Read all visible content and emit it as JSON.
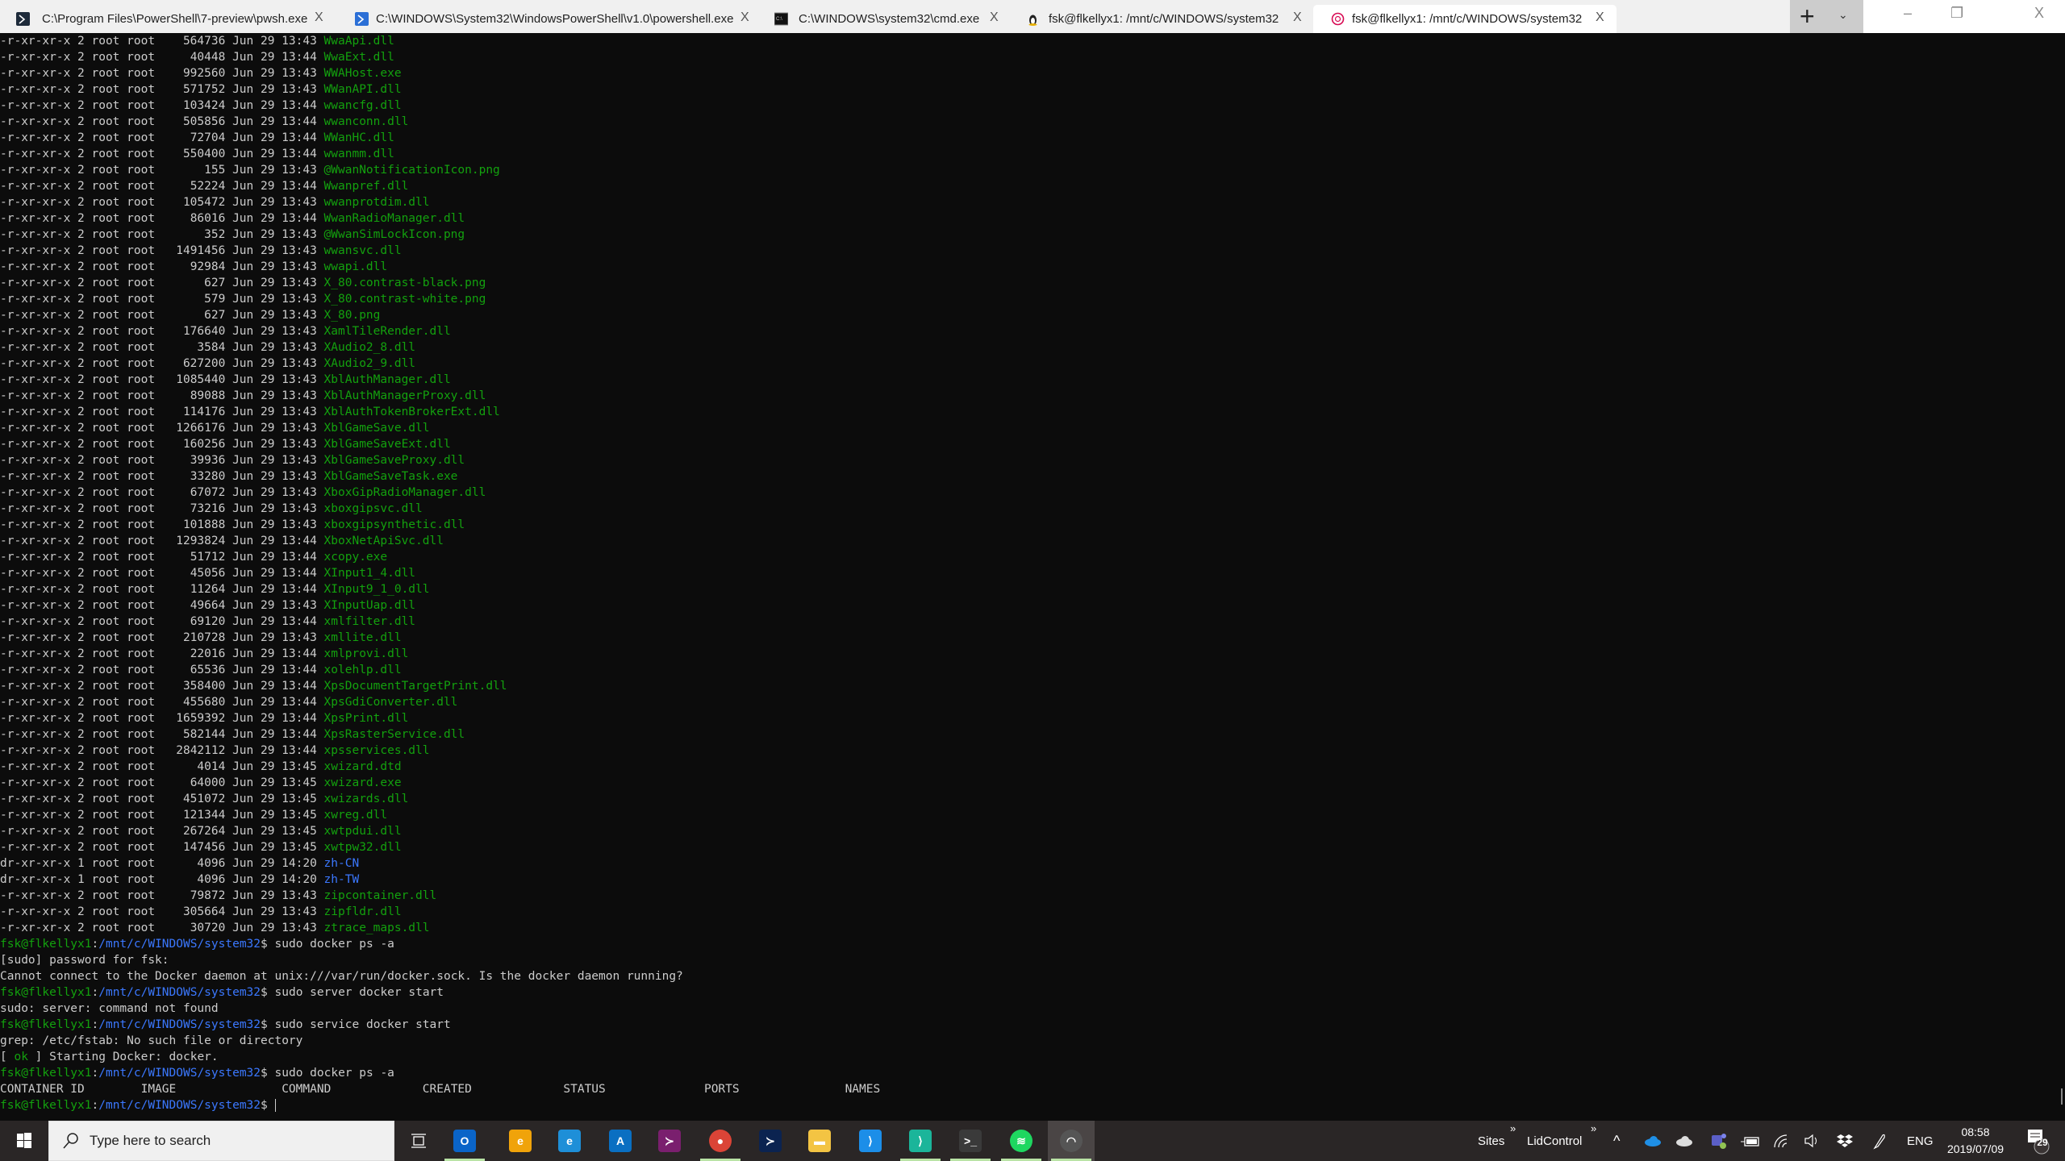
{
  "tabs": [
    {
      "label": "C:\\Program Files\\PowerShell\\7-preview\\pwsh.exe",
      "icon": "pwsh-icon",
      "active": false
    },
    {
      "label": "C:\\WINDOWS\\System32\\WindowsPowerShell\\v1.0\\powershell.exe",
      "icon": "powershell-icon",
      "active": false
    },
    {
      "label": "C:\\WINDOWS\\system32\\cmd.exe",
      "icon": "cmd-icon",
      "active": false
    },
    {
      "label": "fsk@flkellyx1: /mnt/c/WINDOWS/system32",
      "icon": "linux-penguin-icon",
      "active": false
    },
    {
      "label": "fsk@flkellyx1: /mnt/c/WINDOWS/system32",
      "icon": "debian-icon",
      "active": true
    }
  ],
  "tab_close": "X",
  "new_tab": "+",
  "dropdown": "⌄",
  "window_controls": {
    "minimize": "–",
    "restore": "❐",
    "close": "X"
  },
  "colors": {
    "bg": "#0c0c0c",
    "fg": "#cccccc",
    "green": "#13a10e",
    "blue": "#3b78ff",
    "taskbar": "#2a2626"
  },
  "listing": [
    [
      "-r-xr-xr-x",
      "2",
      "root",
      "root",
      "564736",
      "Jun 29",
      "13:43",
      "WwaApi.dll",
      "f"
    ],
    [
      "-r-xr-xr-x",
      "2",
      "root",
      "root",
      "40448",
      "Jun 29",
      "13:44",
      "WwaExt.dll",
      "f"
    ],
    [
      "-r-xr-xr-x",
      "2",
      "root",
      "root",
      "992560",
      "Jun 29",
      "13:43",
      "WWAHost.exe",
      "f"
    ],
    [
      "-r-xr-xr-x",
      "2",
      "root",
      "root",
      "571752",
      "Jun 29",
      "13:43",
      "WWanAPI.dll",
      "f"
    ],
    [
      "-r-xr-xr-x",
      "2",
      "root",
      "root",
      "103424",
      "Jun 29",
      "13:44",
      "wwancfg.dll",
      "f"
    ],
    [
      "-r-xr-xr-x",
      "2",
      "root",
      "root",
      "505856",
      "Jun 29",
      "13:44",
      "wwanconn.dll",
      "f"
    ],
    [
      "-r-xr-xr-x",
      "2",
      "root",
      "root",
      "72704",
      "Jun 29",
      "13:44",
      "WWanHC.dll",
      "f"
    ],
    [
      "-r-xr-xr-x",
      "2",
      "root",
      "root",
      "550400",
      "Jun 29",
      "13:44",
      "wwanmm.dll",
      "f"
    ],
    [
      "-r-xr-xr-x",
      "2",
      "root",
      "root",
      "155",
      "Jun 29",
      "13:43",
      "@WwanNotificationIcon.png",
      "f"
    ],
    [
      "-r-xr-xr-x",
      "2",
      "root",
      "root",
      "52224",
      "Jun 29",
      "13:44",
      "Wwanpref.dll",
      "f"
    ],
    [
      "-r-xr-xr-x",
      "2",
      "root",
      "root",
      "105472",
      "Jun 29",
      "13:43",
      "wwanprotdim.dll",
      "f"
    ],
    [
      "-r-xr-xr-x",
      "2",
      "root",
      "root",
      "86016",
      "Jun 29",
      "13:44",
      "WwanRadioManager.dll",
      "f"
    ],
    [
      "-r-xr-xr-x",
      "2",
      "root",
      "root",
      "352",
      "Jun 29",
      "13:43",
      "@WwanSimLockIcon.png",
      "f"
    ],
    [
      "-r-xr-xr-x",
      "2",
      "root",
      "root",
      "1491456",
      "Jun 29",
      "13:43",
      "wwansvc.dll",
      "f"
    ],
    [
      "-r-xr-xr-x",
      "2",
      "root",
      "root",
      "92984",
      "Jun 29",
      "13:43",
      "wwapi.dll",
      "f"
    ],
    [
      "-r-xr-xr-x",
      "2",
      "root",
      "root",
      "627",
      "Jun 29",
      "13:43",
      "X_80.contrast-black.png",
      "f"
    ],
    [
      "-r-xr-xr-x",
      "2",
      "root",
      "root",
      "579",
      "Jun 29",
      "13:43",
      "X_80.contrast-white.png",
      "f"
    ],
    [
      "-r-xr-xr-x",
      "2",
      "root",
      "root",
      "627",
      "Jun 29",
      "13:43",
      "X_80.png",
      "f"
    ],
    [
      "-r-xr-xr-x",
      "2",
      "root",
      "root",
      "176640",
      "Jun 29",
      "13:43",
      "XamlTileRender.dll",
      "f"
    ],
    [
      "-r-xr-xr-x",
      "2",
      "root",
      "root",
      "3584",
      "Jun 29",
      "13:43",
      "XAudio2_8.dll",
      "f"
    ],
    [
      "-r-xr-xr-x",
      "2",
      "root",
      "root",
      "627200",
      "Jun 29",
      "13:43",
      "XAudio2_9.dll",
      "f"
    ],
    [
      "-r-xr-xr-x",
      "2",
      "root",
      "root",
      "1085440",
      "Jun 29",
      "13:43",
      "XblAuthManager.dll",
      "f"
    ],
    [
      "-r-xr-xr-x",
      "2",
      "root",
      "root",
      "89088",
      "Jun 29",
      "13:43",
      "XblAuthManagerProxy.dll",
      "f"
    ],
    [
      "-r-xr-xr-x",
      "2",
      "root",
      "root",
      "114176",
      "Jun 29",
      "13:43",
      "XblAuthTokenBrokerExt.dll",
      "f"
    ],
    [
      "-r-xr-xr-x",
      "2",
      "root",
      "root",
      "1266176",
      "Jun 29",
      "13:43",
      "XblGameSave.dll",
      "f"
    ],
    [
      "-r-xr-xr-x",
      "2",
      "root",
      "root",
      "160256",
      "Jun 29",
      "13:43",
      "XblGameSaveExt.dll",
      "f"
    ],
    [
      "-r-xr-xr-x",
      "2",
      "root",
      "root",
      "39936",
      "Jun 29",
      "13:43",
      "XblGameSaveProxy.dll",
      "f"
    ],
    [
      "-r-xr-xr-x",
      "2",
      "root",
      "root",
      "33280",
      "Jun 29",
      "13:43",
      "XblGameSaveTask.exe",
      "f"
    ],
    [
      "-r-xr-xr-x",
      "2",
      "root",
      "root",
      "67072",
      "Jun 29",
      "13:43",
      "XboxGipRadioManager.dll",
      "f"
    ],
    [
      "-r-xr-xr-x",
      "2",
      "root",
      "root",
      "73216",
      "Jun 29",
      "13:43",
      "xboxgipsvc.dll",
      "f"
    ],
    [
      "-r-xr-xr-x",
      "2",
      "root",
      "root",
      "101888",
      "Jun 29",
      "13:43",
      "xboxgipsynthetic.dll",
      "f"
    ],
    [
      "-r-xr-xr-x",
      "2",
      "root",
      "root",
      "1293824",
      "Jun 29",
      "13:44",
      "XboxNetApiSvc.dll",
      "f"
    ],
    [
      "-r-xr-xr-x",
      "2",
      "root",
      "root",
      "51712",
      "Jun 29",
      "13:44",
      "xcopy.exe",
      "f"
    ],
    [
      "-r-xr-xr-x",
      "2",
      "root",
      "root",
      "45056",
      "Jun 29",
      "13:44",
      "XInput1_4.dll",
      "f"
    ],
    [
      "-r-xr-xr-x",
      "2",
      "root",
      "root",
      "11264",
      "Jun 29",
      "13:44",
      "XInput9_1_0.dll",
      "f"
    ],
    [
      "-r-xr-xr-x",
      "2",
      "root",
      "root",
      "49664",
      "Jun 29",
      "13:43",
      "XInputUap.dll",
      "f"
    ],
    [
      "-r-xr-xr-x",
      "2",
      "root",
      "root",
      "69120",
      "Jun 29",
      "13:44",
      "xmlfilter.dll",
      "f"
    ],
    [
      "-r-xr-xr-x",
      "2",
      "root",
      "root",
      "210728",
      "Jun 29",
      "13:43",
      "xmllite.dll",
      "f"
    ],
    [
      "-r-xr-xr-x",
      "2",
      "root",
      "root",
      "22016",
      "Jun 29",
      "13:44",
      "xmlprovi.dll",
      "f"
    ],
    [
      "-r-xr-xr-x",
      "2",
      "root",
      "root",
      "65536",
      "Jun 29",
      "13:44",
      "xolehlp.dll",
      "f"
    ],
    [
      "-r-xr-xr-x",
      "2",
      "root",
      "root",
      "358400",
      "Jun 29",
      "13:44",
      "XpsDocumentTargetPrint.dll",
      "f"
    ],
    [
      "-r-xr-xr-x",
      "2",
      "root",
      "root",
      "455680",
      "Jun 29",
      "13:44",
      "XpsGdiConverter.dll",
      "f"
    ],
    [
      "-r-xr-xr-x",
      "2",
      "root",
      "root",
      "1659392",
      "Jun 29",
      "13:44",
      "XpsPrint.dll",
      "f"
    ],
    [
      "-r-xr-xr-x",
      "2",
      "root",
      "root",
      "582144",
      "Jun 29",
      "13:44",
      "XpsRasterService.dll",
      "f"
    ],
    [
      "-r-xr-xr-x",
      "2",
      "root",
      "root",
      "2842112",
      "Jun 29",
      "13:44",
      "xpsservices.dll",
      "f"
    ],
    [
      "-r-xr-xr-x",
      "2",
      "root",
      "root",
      "4014",
      "Jun 29",
      "13:45",
      "xwizard.dtd",
      "f"
    ],
    [
      "-r-xr-xr-x",
      "2",
      "root",
      "root",
      "64000",
      "Jun 29",
      "13:45",
      "xwizard.exe",
      "f"
    ],
    [
      "-r-xr-xr-x",
      "2",
      "root",
      "root",
      "451072",
      "Jun 29",
      "13:45",
      "xwizards.dll",
      "f"
    ],
    [
      "-r-xr-xr-x",
      "2",
      "root",
      "root",
      "121344",
      "Jun 29",
      "13:45",
      "xwreg.dll",
      "f"
    ],
    [
      "-r-xr-xr-x",
      "2",
      "root",
      "root",
      "267264",
      "Jun 29",
      "13:45",
      "xwtpdui.dll",
      "f"
    ],
    [
      "-r-xr-xr-x",
      "2",
      "root",
      "root",
      "147456",
      "Jun 29",
      "13:45",
      "xwtpw32.dll",
      "f"
    ],
    [
      "dr-xr-xr-x",
      "1",
      "root",
      "root",
      "4096",
      "Jun 29",
      "14:20",
      "zh-CN",
      "d"
    ],
    [
      "dr-xr-xr-x",
      "1",
      "root",
      "root",
      "4096",
      "Jun 29",
      "14:20",
      "zh-TW",
      "d"
    ],
    [
      "-r-xr-xr-x",
      "2",
      "root",
      "root",
      "79872",
      "Jun 29",
      "13:43",
      "zipcontainer.dll",
      "f"
    ],
    [
      "-r-xr-xr-x",
      "2",
      "root",
      "root",
      "305664",
      "Jun 29",
      "13:43",
      "zipfldr.dll",
      "f"
    ],
    [
      "-r-xr-xr-x",
      "2",
      "root",
      "root",
      "30720",
      "Jun 29",
      "13:43",
      "ztrace_maps.dll",
      "f"
    ]
  ],
  "prompt": {
    "user": "fsk@flkellyx1",
    "sep": ":",
    "path": "/mnt/c/WINDOWS/system32",
    "sym": "$ "
  },
  "session": [
    {
      "type": "prompt",
      "cmd": "sudo docker ps -a"
    },
    {
      "type": "out",
      "text": "[sudo] password for fsk:"
    },
    {
      "type": "out",
      "text": "Cannot connect to the Docker daemon at unix:///var/run/docker.sock. Is the docker daemon running?"
    },
    {
      "type": "prompt",
      "cmd": "sudo server docker start"
    },
    {
      "type": "out",
      "text": "sudo: server: command not found"
    },
    {
      "type": "prompt",
      "cmd": "sudo service docker start"
    },
    {
      "type": "out",
      "text": "grep: /etc/fstab: No such file or directory"
    },
    {
      "type": "ok",
      "pre": "[ ",
      "ok": "ok",
      "post": " ] Starting Docker: docker."
    },
    {
      "type": "prompt",
      "cmd": "sudo docker ps -a"
    },
    {
      "type": "header",
      "cols": [
        "CONTAINER ID",
        "IMAGE",
        "COMMAND",
        "CREATED",
        "STATUS",
        "PORTS",
        "NAMES"
      ]
    },
    {
      "type": "prompt",
      "cmd": "",
      "cursor": true
    }
  ],
  "taskbar": {
    "search_placeholder": "Type here to search",
    "apps": [
      {
        "name": "outlook",
        "glyph": "O",
        "color": "#0a64c8",
        "running": true
      },
      {
        "name": "edge-canary",
        "glyph": "e",
        "color": "#f0a30a",
        "running": false
      },
      {
        "name": "edge-dev",
        "glyph": "e",
        "color": "#1e8fd8",
        "running": false
      },
      {
        "name": "azure",
        "glyph": "A",
        "color": "#0a6fc2",
        "running": false
      },
      {
        "name": "powershell-preview",
        "glyph": "≻",
        "color": "#7a1f6e",
        "running": false
      },
      {
        "name": "chrome",
        "glyph": "●",
        "color": "#db4437",
        "running": true
      },
      {
        "name": "powershell-dark",
        "glyph": "≻",
        "color": "#0b2350",
        "running": false
      },
      {
        "name": "file-explorer",
        "glyph": "▬",
        "color": "#f3c443",
        "running": false
      },
      {
        "name": "vscode",
        "glyph": "⟩",
        "color": "#1c8ee8",
        "running": false
      },
      {
        "name": "vscode-insiders",
        "glyph": "⟩",
        "color": "#1bb59a",
        "running": true
      },
      {
        "name": "windows-terminal",
        "glyph": ">_",
        "color": "#3a3a3a",
        "running": true
      },
      {
        "name": "spotify",
        "glyph": "≋",
        "color": "#1ed760",
        "running": true
      },
      {
        "name": "debian-wsl",
        "glyph": "◠",
        "color": "#555",
        "running": true,
        "active": true
      }
    ],
    "toolbars": [
      "Sites",
      "LidControl"
    ],
    "toolbar_chevron": "»",
    "tray_up": "^",
    "language": "ENG",
    "time": "08:58",
    "date": "2019/07/09",
    "notifications": "29"
  }
}
